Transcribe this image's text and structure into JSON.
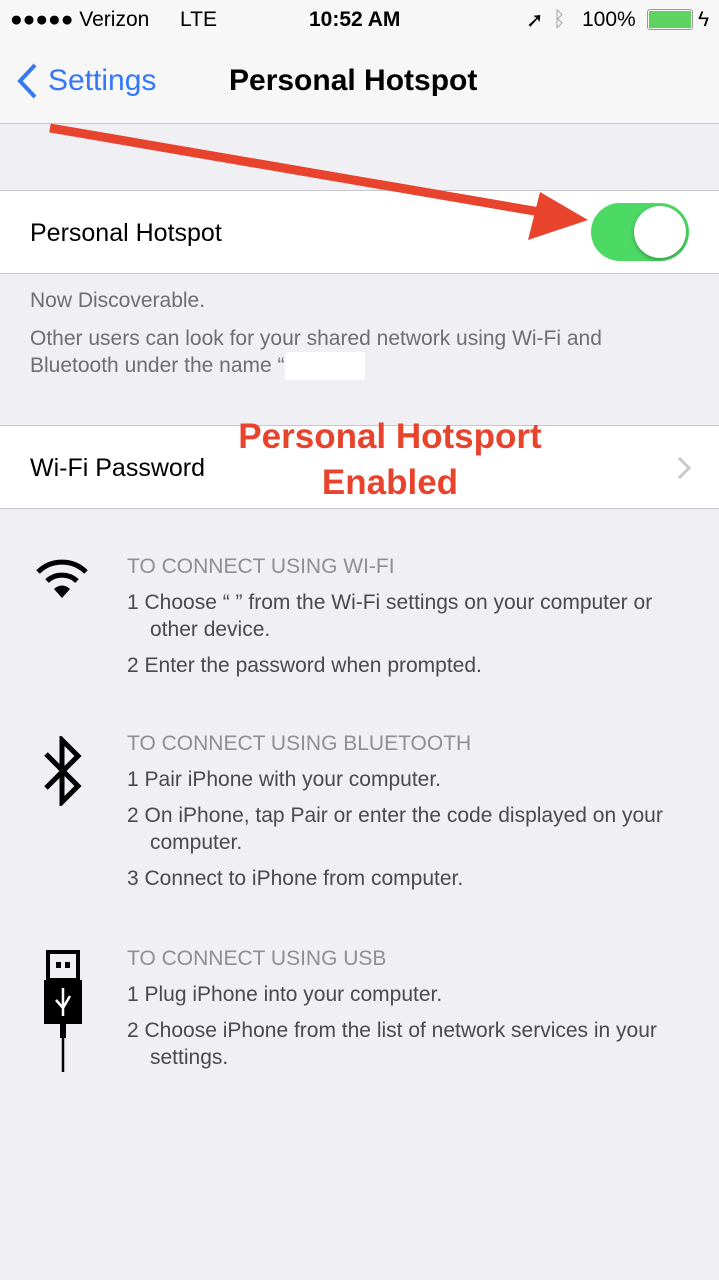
{
  "status_bar": {
    "carrier": "●●●●● Verizon",
    "network": "LTE",
    "time": "10:52 AM",
    "battery": "100%",
    "battery_color": "#5fd35f"
  },
  "nav": {
    "back_label": "Settings",
    "title": "Personal Hotspot",
    "accent": "#3478f6"
  },
  "hotspot": {
    "label": "Personal Hotspot",
    "enabled": true,
    "toggle_color": "#4cd964"
  },
  "discoverable": {
    "line1": "Now Discoverable.",
    "line2": "Other users can look for your shared network using Wi-Fi and Bluetooth under the name “"
  },
  "wifi_password": {
    "label": "Wi-Fi Password"
  },
  "annotation": {
    "line1": "Personal Hotsport",
    "line2": "Enabled",
    "color": "#e8432d"
  },
  "sections": [
    {
      "icon": "wifi-icon",
      "heading": "TO CONNECT USING WI-FI",
      "steps": [
        "1 Choose “ ” from the Wi-Fi settings on your computer or other device.",
        "2 Enter the password when prompted."
      ]
    },
    {
      "icon": "bluetooth-icon",
      "heading": "TO CONNECT USING BLUETOOTH",
      "steps": [
        "1 Pair iPhone with your computer.",
        "2 On iPhone, tap Pair or enter the code displayed on your computer.",
        "3 Connect to iPhone from computer."
      ]
    },
    {
      "icon": "usb-icon",
      "heading": "TO CONNECT USING USB",
      "steps": [
        "1 Plug iPhone into your computer.",
        "2 Choose iPhone from the list of network services in your settings."
      ]
    }
  ]
}
